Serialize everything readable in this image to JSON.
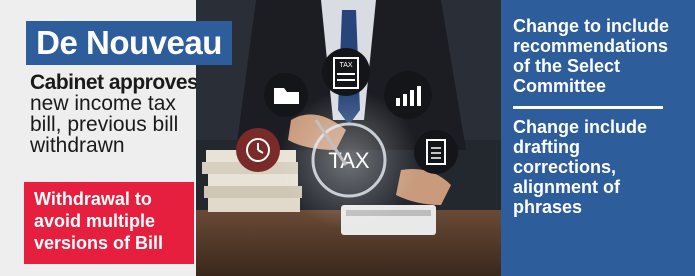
{
  "brand": {
    "title": "De Nouveau"
  },
  "headline": {
    "bold": "Cabinet approves",
    "line1": "new income tax",
    "line2": "bill, previous bill",
    "line3": "withdrawn"
  },
  "highlight": {
    "text": "Withdrawal to avoid multiple versions of Bill"
  },
  "photo": {
    "center_label": "TAX",
    "icon_label": "TAX"
  },
  "right_panel": {
    "point1": "Change to include recommendations of the Select Committee",
    "point2": "Change include drafting corrections, alignment of phrases"
  },
  "colors": {
    "brand_blue": "#2d5d9a",
    "alert_red": "#e61f3e",
    "panel_bg": "#eeeeee"
  }
}
